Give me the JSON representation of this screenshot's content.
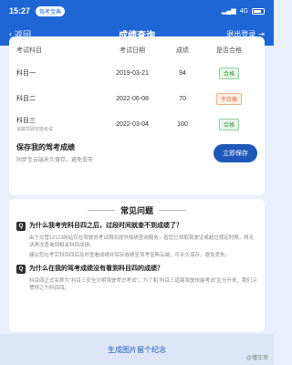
{
  "status_bar": {
    "time": "15:27",
    "pill": "驾考宝典",
    "network": "4G",
    "battery": ""
  },
  "nav": {
    "back": "返回",
    "title": "成绩查询",
    "logout": "退出登录"
  },
  "table": {
    "headers": [
      "考试科目",
      "考试日期",
      "成绩",
      "是否合格"
    ],
    "rows": [
      {
        "subject": "科目一",
        "subject_sub": "",
        "date": "2019-03-21",
        "score": "94",
        "status": "合格",
        "status_type": "pass"
      },
      {
        "subject": "科目二",
        "subject_sub": "",
        "date": "2022-06-08",
        "score": "70",
        "status": "不合格",
        "status_type": "fail"
      },
      {
        "subject": "科目三",
        "subject_sub": "道路驾驶技能考试",
        "date": "2022-03-04",
        "score": "100",
        "status": "合格",
        "status_type": "pass"
      }
    ]
  },
  "save": {
    "title": "保存我的驾考成绩",
    "subtitle": "同步至云端永久保存，避免丢失",
    "button": "立即保存"
  },
  "faq": {
    "title": "常见问题",
    "items": [
      {
        "icon": "Q",
        "question": "为什么我考完科目四之后，过段时间就查不到成绩了？",
        "answers": [
          "由于交管12123网站仅在驾驶员考试期间提供成绩查询服务，若您已领取驾驶证或超过规定时限，将无法再次查询到相关科目成绩。",
          "建议您在考完科目四后及时查看成绩并保存成绩至驾考宝典云端，可永久保存，避免丢失。"
        ]
      },
      {
        "icon": "Q",
        "question": "为什么在我的驾考成绩没有看到科目四的成绩？",
        "answers": [
          "科目四正式名称为“科目三安全文明驾驶常识考试”，为了和“科目三道路驾驶技能考试”区分开来，我们习惯称之为科目四。"
        ]
      }
    ]
  },
  "bottom": {
    "button": "生成图片留个纪念",
    "watermark": "@懂车帝"
  }
}
